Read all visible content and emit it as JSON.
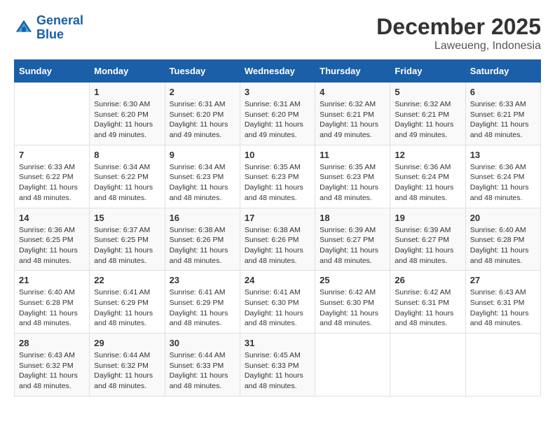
{
  "header": {
    "logo_line1": "General",
    "logo_line2": "Blue",
    "month": "December 2025",
    "location": "Laweueng, Indonesia"
  },
  "weekdays": [
    "Sunday",
    "Monday",
    "Tuesday",
    "Wednesday",
    "Thursday",
    "Friday",
    "Saturday"
  ],
  "weeks": [
    [
      {
        "day": "",
        "sunrise": "",
        "sunset": "",
        "daylight": ""
      },
      {
        "day": "1",
        "sunrise": "Sunrise: 6:30 AM",
        "sunset": "Sunset: 6:20 PM",
        "daylight": "Daylight: 11 hours and 49 minutes."
      },
      {
        "day": "2",
        "sunrise": "Sunrise: 6:31 AM",
        "sunset": "Sunset: 6:20 PM",
        "daylight": "Daylight: 11 hours and 49 minutes."
      },
      {
        "day": "3",
        "sunrise": "Sunrise: 6:31 AM",
        "sunset": "Sunset: 6:20 PM",
        "daylight": "Daylight: 11 hours and 49 minutes."
      },
      {
        "day": "4",
        "sunrise": "Sunrise: 6:32 AM",
        "sunset": "Sunset: 6:21 PM",
        "daylight": "Daylight: 11 hours and 49 minutes."
      },
      {
        "day": "5",
        "sunrise": "Sunrise: 6:32 AM",
        "sunset": "Sunset: 6:21 PM",
        "daylight": "Daylight: 11 hours and 49 minutes."
      },
      {
        "day": "6",
        "sunrise": "Sunrise: 6:33 AM",
        "sunset": "Sunset: 6:21 PM",
        "daylight": "Daylight: 11 hours and 48 minutes."
      }
    ],
    [
      {
        "day": "7",
        "sunrise": "Sunrise: 6:33 AM",
        "sunset": "Sunset: 6:22 PM",
        "daylight": "Daylight: 11 hours and 48 minutes."
      },
      {
        "day": "8",
        "sunrise": "Sunrise: 6:34 AM",
        "sunset": "Sunset: 6:22 PM",
        "daylight": "Daylight: 11 hours and 48 minutes."
      },
      {
        "day": "9",
        "sunrise": "Sunrise: 6:34 AM",
        "sunset": "Sunset: 6:23 PM",
        "daylight": "Daylight: 11 hours and 48 minutes."
      },
      {
        "day": "10",
        "sunrise": "Sunrise: 6:35 AM",
        "sunset": "Sunset: 6:23 PM",
        "daylight": "Daylight: 11 hours and 48 minutes."
      },
      {
        "day": "11",
        "sunrise": "Sunrise: 6:35 AM",
        "sunset": "Sunset: 6:23 PM",
        "daylight": "Daylight: 11 hours and 48 minutes."
      },
      {
        "day": "12",
        "sunrise": "Sunrise: 6:36 AM",
        "sunset": "Sunset: 6:24 PM",
        "daylight": "Daylight: 11 hours and 48 minutes."
      },
      {
        "day": "13",
        "sunrise": "Sunrise: 6:36 AM",
        "sunset": "Sunset: 6:24 PM",
        "daylight": "Daylight: 11 hours and 48 minutes."
      }
    ],
    [
      {
        "day": "14",
        "sunrise": "Sunrise: 6:36 AM",
        "sunset": "Sunset: 6:25 PM",
        "daylight": "Daylight: 11 hours and 48 minutes."
      },
      {
        "day": "15",
        "sunrise": "Sunrise: 6:37 AM",
        "sunset": "Sunset: 6:25 PM",
        "daylight": "Daylight: 11 hours and 48 minutes."
      },
      {
        "day": "16",
        "sunrise": "Sunrise: 6:38 AM",
        "sunset": "Sunset: 6:26 PM",
        "daylight": "Daylight: 11 hours and 48 minutes."
      },
      {
        "day": "17",
        "sunrise": "Sunrise: 6:38 AM",
        "sunset": "Sunset: 6:26 PM",
        "daylight": "Daylight: 11 hours and 48 minutes."
      },
      {
        "day": "18",
        "sunrise": "Sunrise: 6:39 AM",
        "sunset": "Sunset: 6:27 PM",
        "daylight": "Daylight: 11 hours and 48 minutes."
      },
      {
        "day": "19",
        "sunrise": "Sunrise: 6:39 AM",
        "sunset": "Sunset: 6:27 PM",
        "daylight": "Daylight: 11 hours and 48 minutes."
      },
      {
        "day": "20",
        "sunrise": "Sunrise: 6:40 AM",
        "sunset": "Sunset: 6:28 PM",
        "daylight": "Daylight: 11 hours and 48 minutes."
      }
    ],
    [
      {
        "day": "21",
        "sunrise": "Sunrise: 6:40 AM",
        "sunset": "Sunset: 6:28 PM",
        "daylight": "Daylight: 11 hours and 48 minutes."
      },
      {
        "day": "22",
        "sunrise": "Sunrise: 6:41 AM",
        "sunset": "Sunset: 6:29 PM",
        "daylight": "Daylight: 11 hours and 48 minutes."
      },
      {
        "day": "23",
        "sunrise": "Sunrise: 6:41 AM",
        "sunset": "Sunset: 6:29 PM",
        "daylight": "Daylight: 11 hours and 48 minutes."
      },
      {
        "day": "24",
        "sunrise": "Sunrise: 6:41 AM",
        "sunset": "Sunset: 6:30 PM",
        "daylight": "Daylight: 11 hours and 48 minutes."
      },
      {
        "day": "25",
        "sunrise": "Sunrise: 6:42 AM",
        "sunset": "Sunset: 6:30 PM",
        "daylight": "Daylight: 11 hours and 48 minutes."
      },
      {
        "day": "26",
        "sunrise": "Sunrise: 6:42 AM",
        "sunset": "Sunset: 6:31 PM",
        "daylight": "Daylight: 11 hours and 48 minutes."
      },
      {
        "day": "27",
        "sunrise": "Sunrise: 6:43 AM",
        "sunset": "Sunset: 6:31 PM",
        "daylight": "Daylight: 11 hours and 48 minutes."
      }
    ],
    [
      {
        "day": "28",
        "sunrise": "Sunrise: 6:43 AM",
        "sunset": "Sunset: 6:32 PM",
        "daylight": "Daylight: 11 hours and 48 minutes."
      },
      {
        "day": "29",
        "sunrise": "Sunrise: 6:44 AM",
        "sunset": "Sunset: 6:32 PM",
        "daylight": "Daylight: 11 hours and 48 minutes."
      },
      {
        "day": "30",
        "sunrise": "Sunrise: 6:44 AM",
        "sunset": "Sunset: 6:33 PM",
        "daylight": "Daylight: 11 hours and 48 minutes."
      },
      {
        "day": "31",
        "sunrise": "Sunrise: 6:45 AM",
        "sunset": "Sunset: 6:33 PM",
        "daylight": "Daylight: 11 hours and 48 minutes."
      },
      {
        "day": "",
        "sunrise": "",
        "sunset": "",
        "daylight": ""
      },
      {
        "day": "",
        "sunrise": "",
        "sunset": "",
        "daylight": ""
      },
      {
        "day": "",
        "sunrise": "",
        "sunset": "",
        "daylight": ""
      }
    ]
  ]
}
